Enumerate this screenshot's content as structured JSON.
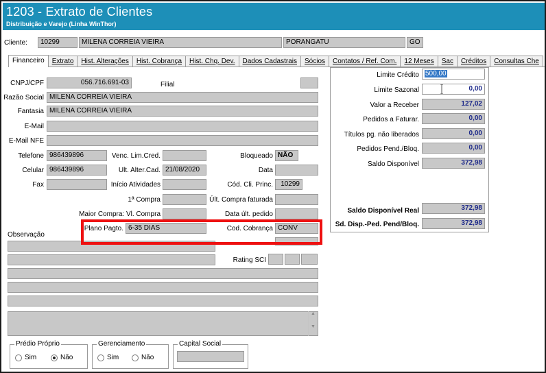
{
  "window": {
    "title": "1203 - Extrato de Clientes",
    "subtitle": "Distribuição e Varejo (Linha WinThor)"
  },
  "client": {
    "label": "Cliente:",
    "code": "10299",
    "name": "MILENA CORREIA VIEIRA",
    "city": "PORANGATU",
    "state": "GO"
  },
  "tabs": [
    {
      "label": "Financeiro"
    },
    {
      "label": "Extrato"
    },
    {
      "label": "Hist. Alterações"
    },
    {
      "label": "Hist. Cobrança"
    },
    {
      "label": "Hist. Chq. Dev."
    },
    {
      "label": "Dados Cadastrais"
    },
    {
      "label": "Sócios"
    },
    {
      "label": "Contatos / Ref. Com."
    },
    {
      "label": "12 Meses"
    },
    {
      "label": "Sac"
    },
    {
      "label": "Créditos"
    },
    {
      "label": "Consultas Che"
    }
  ],
  "form": {
    "cnpj_label": "CNPJ/CPF",
    "cnpj": "056.716.691-03",
    "filial_label": "Filial",
    "filial": "",
    "razao_label": "Razão Social",
    "razao": "MILENA CORREIA VIEIRA",
    "fantasia_label": "Fantasia",
    "fantasia": "MILENA CORREIA VIEIRA",
    "email_label": "E-Mail",
    "email": "",
    "email_nfe_label": "E-Mail NFE",
    "email_nfe": "",
    "telefone_label": "Telefone",
    "telefone": "986439896",
    "celular_label": "Celular",
    "celular": "986439896",
    "fax_label": "Fax",
    "fax": "",
    "venc_lim_label": "Venc. Lim.Cred.",
    "venc_lim": "",
    "ult_alter_label": "Ult. Alter.Cad.",
    "ult_alter": "21/08/2020",
    "inicio_ativ_label": "Início Atividades",
    "inicio_ativ": "",
    "primeira_compra_label": "1ª Compra",
    "primeira_compra": "",
    "maior_compra_label": "Maior Compra: Vl. Compra",
    "maior_compra": "",
    "plano_label": "Plano Pagto.",
    "plano": "6-35 DIAS",
    "bloqueado_label": "Bloqueado",
    "bloqueado": "NÃO",
    "data_label": "Data",
    "data": "",
    "cod_cli_princ_label": "Cód. Cli. Princ.",
    "cod_cli_princ": "10299",
    "ult_compra_fat_label": "Últ. Compra faturada",
    "ult_compra_fat": "",
    "data_ult_pedido_label": "Data últ. pedido",
    "data_ult_pedido": "",
    "cod_cobranca_label": "Cod. Cobrança",
    "cod_cobranca": "CONV",
    "rating_label": "Rating SCI",
    "observacao_label": "Observação"
  },
  "credit": {
    "limite_credito_label": "Limite Crédito",
    "limite_credito": "500,00",
    "limite_sazonal_label": "Limite Sazonal",
    "limite_sazonal": "0,00",
    "valor_receber_label": "Valor a Receber",
    "valor_receber": "127,02",
    "pedidos_faturar_label": "Pedidos a Faturar.",
    "pedidos_faturar": "0,00",
    "titulos_label": "Títulos pg. não liberados",
    "titulos": "0,00",
    "pedidos_pend_label": "Pedidos Pend./Bloq.",
    "pedidos_pend": "0,00",
    "saldo_disp_label": "Saldo Disponível",
    "saldo_disp": "372,98",
    "saldo_real_label": "Saldo Disponível Real",
    "saldo_real": "372,98",
    "sd_disp_pend_label": "Sd. Disp.-Ped. Pend/Bloq.",
    "sd_disp_pend": "372,98"
  },
  "bottom": {
    "predio_title": "Prédio Próprio",
    "predio_sim": "Sim",
    "predio_nao": "Não",
    "predio_selected": "Não",
    "gerenc_title": "Gerenciamento",
    "gerenc_sim": "Sim",
    "gerenc_nao": "Não",
    "capital_title": "Capital Social",
    "capital": ""
  },
  "colors": {
    "titlebar": "#1d8fb8",
    "highlight": "#ee1111",
    "value_blue": "#1e2a8a"
  }
}
